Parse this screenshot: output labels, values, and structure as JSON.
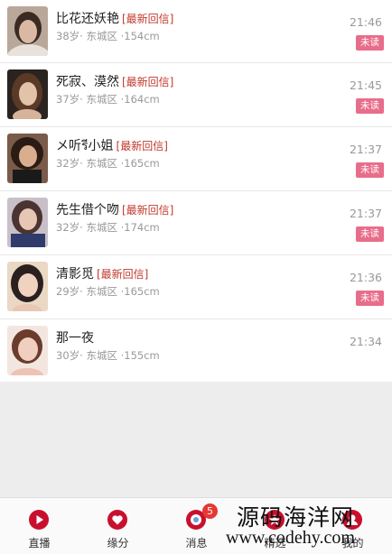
{
  "conversations": [
    {
      "name": "比花还妖艳",
      "tag": "[最新回信]",
      "meta": "38岁· 东城区 ·154cm",
      "time": "21:46",
      "badge": "未读",
      "skin": "#d9b9a3",
      "hair": "#3b2a22"
    },
    {
      "name": "死寂、漠然",
      "tag": "[最新回信]",
      "meta": "37岁· 东城区 ·164cm",
      "time": "21:45",
      "badge": "未读",
      "skin": "#e2c2a8",
      "hair": "#5a3a26"
    },
    {
      "name": "メ听รี小姐",
      "tag": "[最新回信]",
      "meta": "32岁· 东城区 ·165cm",
      "time": "21:37",
      "badge": "未读",
      "skin": "#d8ae8f",
      "hair": "#2a1b14"
    },
    {
      "name": "先生借个吻",
      "tag": "[最新回信]",
      "meta": "32岁· 东城区 ·174cm",
      "time": "21:37",
      "badge": "未读",
      "skin": "#e6c7b6",
      "hair": "#4a3330"
    },
    {
      "name": "清影觅",
      "tag": "[最新回信]",
      "meta": "29岁· 东城区 ·165cm",
      "time": "21:36",
      "badge": "未读",
      "skin": "#efd3bf",
      "hair": "#2b2020"
    },
    {
      "name": "那一夜",
      "tag": "",
      "meta": "30岁· 东城区 ·155cm",
      "time": "21:34",
      "badge": "",
      "skin": "#f0cfc0",
      "hair": "#6b3c2c"
    }
  ],
  "tabbar": {
    "tabs": [
      {
        "label": "直播",
        "icon": "play-icon"
      },
      {
        "label": "缘分",
        "icon": "heart-icon"
      },
      {
        "label": "消息",
        "icon": "message-icon",
        "badge": "5"
      },
      {
        "label": "精选",
        "icon": "star-icon"
      },
      {
        "label": "我的",
        "icon": "user-icon"
      }
    ]
  },
  "watermark": {
    "line1": "源码海洋网",
    "line2": "www.codehy.com"
  },
  "colors": {
    "accent": "#c8102e",
    "badge": "#e86d8a",
    "tag": "#c0392b"
  }
}
